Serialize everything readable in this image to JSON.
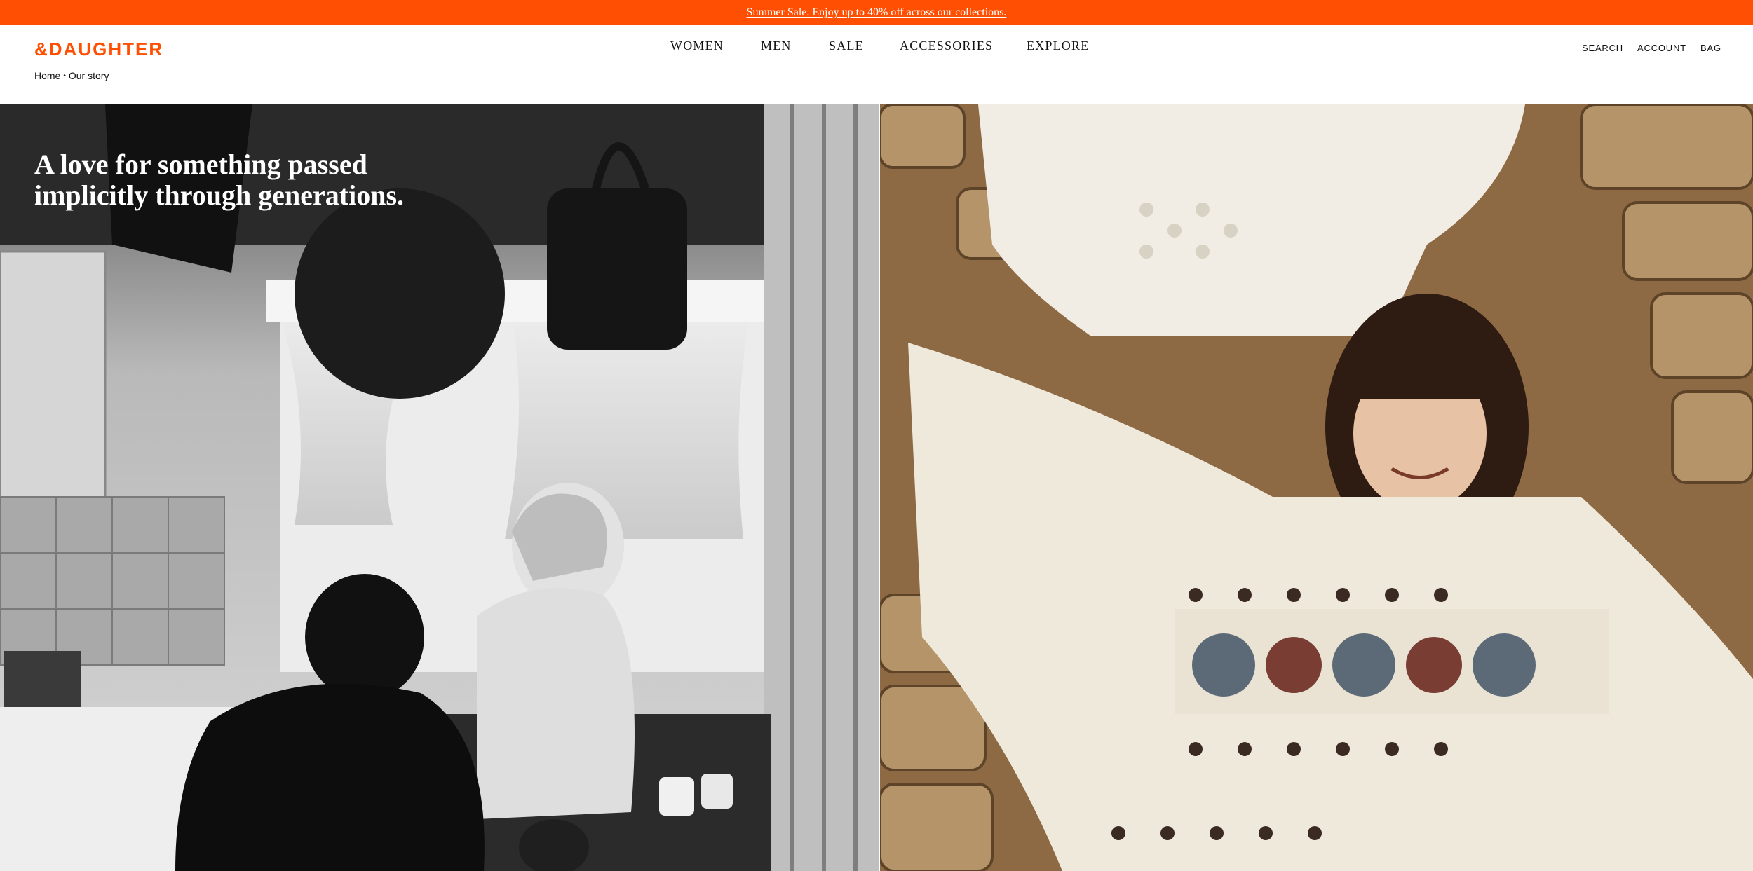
{
  "announcement": {
    "text": "Summer Sale. Enjoy up to 40% off across our collections."
  },
  "header": {
    "logo": "&DAUGHTER",
    "nav": [
      "WOMEN",
      "MEN",
      "SALE",
      "ACCESSORIES",
      "EXPLORE"
    ],
    "utility": [
      "SEARCH",
      "ACCOUNT",
      "BAG"
    ]
  },
  "breadcrumb": {
    "home": "Home",
    "separator": "•",
    "current": "Our story"
  },
  "hero": {
    "heading_line1": "A love for something passed",
    "heading_line2": "implicitly through generations.",
    "left_image": "black-and-white kitchen photo",
    "right_image": "girl wearing knitted sweater photo"
  },
  "colors": {
    "brand": "#ff4f02",
    "text": "#111111",
    "background": "#ffffff"
  }
}
